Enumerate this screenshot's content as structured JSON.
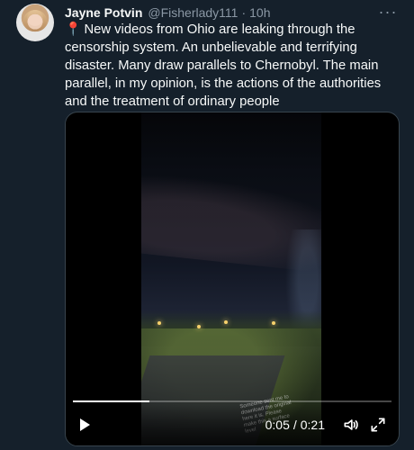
{
  "tweet": {
    "author_name": "Jayne Potvin",
    "handle": "@Fisherlady111",
    "separator": "·",
    "time_ago": "10h",
    "more_label": "···",
    "text_emoji": "📍",
    "text": "New videos from Ohio are leaking through the censorship system. An unbelievable and terrifying disaster. Many draw parallels to Chernobyl. The main parallel, in my opinion, is the actions of the authorities and the treatment of ordinary people"
  },
  "video": {
    "current_time": "0:05",
    "time_separator": "/",
    "duration": "0:21",
    "progress_fraction": 0.24,
    "overlay_caption": "Someone sent me to download the original here it is. Please make this a surface level"
  },
  "icons": {
    "play": "play-icon",
    "volume": "volume-icon",
    "fullscreen": "fullscreen-icon",
    "more": "more-icon",
    "location_pin": "pin-icon"
  },
  "colors": {
    "background": "#15202b",
    "text": "#f7f9f9",
    "muted": "#8b98a5",
    "border": "#38444d",
    "pin": "#ff3b30"
  }
}
